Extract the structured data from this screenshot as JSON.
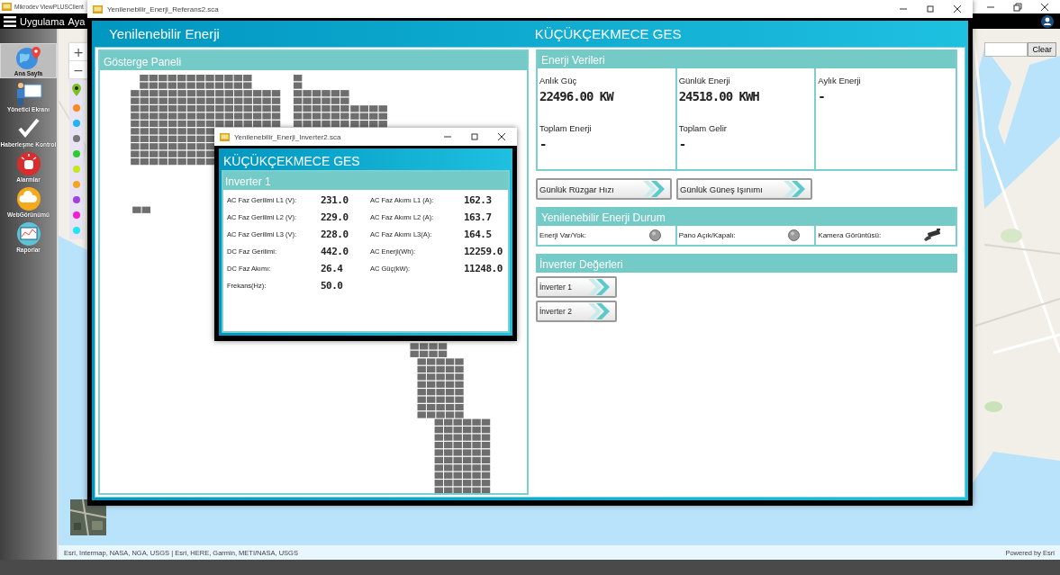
{
  "app": {
    "title": "Mikrodev ViewPLUSClient",
    "menu": [
      "Uygulama",
      "Aya"
    ]
  },
  "sidebar": [
    {
      "label": "Ana Sayfa",
      "kind": "globe",
      "selected": true
    },
    {
      "label": "Yönetici Ekranı",
      "kind": "presenter",
      "selected": false
    },
    {
      "label": "Haberleşme Kontrol",
      "kind": "check",
      "selected": false
    },
    {
      "label": "Alarmlar",
      "kind": "alarm",
      "selected": false
    },
    {
      "label": "WebGörünümü",
      "kind": "cloud",
      "selected": false
    },
    {
      "label": "Raporlar",
      "kind": "report",
      "selected": false
    }
  ],
  "map": {
    "kind": "picture",
    "zoom_in": "+",
    "zoom_out": "−",
    "clear_button": "Clear",
    "layers": [
      {
        "kind": "pin",
        "color": "#7cc11f"
      },
      {
        "kind": "dot",
        "color": "#f58a1f"
      },
      {
        "kind": "dot",
        "color": "#1fb5f5"
      },
      {
        "kind": "dot",
        "color": "#777777"
      },
      {
        "kind": "dot",
        "color": "#2ecc2e"
      },
      {
        "kind": "dot",
        "color": "#c8e61e"
      },
      {
        "kind": "dot",
        "color": "#f5a51f"
      },
      {
        "kind": "dot",
        "color": "#a040e0"
      },
      {
        "kind": "dot",
        "color": "#f020d0"
      },
      {
        "kind": "dot",
        "color": "#20e8f0"
      }
    ],
    "attribution": "Esri, Intermap, NASA, NGA, USGS | Esri, HERE, Garmin, METI/NASA, USGS",
    "powered_by": "Powered by Esri"
  },
  "main_window": {
    "title": "Yenilenebilir_Enerji_Referans2.sca",
    "heading": "Yenilenebilir Enerji",
    "site": "KÜÇÜKÇEKMECE GES",
    "dashboard": {
      "title": "Gösterge Paneli"
    },
    "energy": {
      "title": "Enerji Verileri",
      "columns": [
        {
          "items": [
            {
              "label": "Anlık Güç",
              "value": "22496.00 KW"
            },
            {
              "label": "Toplam Enerji",
              "value": "-"
            }
          ]
        },
        {
          "items": [
            {
              "label": "Günlük Enerji",
              "value": "24518.00 KWH"
            },
            {
              "label": "Toplam Gelir",
              "value": "-"
            }
          ]
        },
        {
          "items": [
            {
              "label": "Aylık Enerji",
              "value": "-"
            }
          ]
        }
      ]
    },
    "buttons": [
      "Günlük Rüzgar Hızı",
      "Günlük Güneş Işınımı"
    ],
    "status": {
      "title": "Yenilenebilir Enerji Durum",
      "items": [
        {
          "label": "Enerji Var/Yok:",
          "kind": "lamp",
          "on": false
        },
        {
          "label": "Pano Açık/Kapalı:",
          "kind": "lamp",
          "on": false
        },
        {
          "label": "Kamera Görüntüsü:",
          "kind": "camera"
        }
      ]
    },
    "inverters": {
      "title": "İnverter Değerleri",
      "buttons": [
        "İnverter 1",
        "İnverter 2"
      ]
    }
  },
  "inverter_window": {
    "title": "Yenilenebilir_Enerji_Inverter2.sca",
    "site": "KÜÇÜKÇEKMECE GES",
    "panel": "Inverter 1",
    "left": [
      {
        "label": "AC Faz Gerilimi L1 (V):",
        "value": "231.0"
      },
      {
        "label": "AC Faz Gerilimi L2 (V):",
        "value": "229.0"
      },
      {
        "label": "AC Faz Gerilimi L3 (V):",
        "value": "228.0"
      },
      {
        "label": "DC Faz Gerilimi:",
        "value": "442.0"
      },
      {
        "label": "DC Faz Akımı:",
        "value": "26.4"
      },
      {
        "label": "Frekans(Hz):",
        "value": "50.0"
      }
    ],
    "right": [
      {
        "label": "AC Faz Akımı L1 (A):",
        "value": "162.3"
      },
      {
        "label": "AC Faz Akımı L2 (A):",
        "value": "163.7"
      },
      {
        "label": "AC Faz Akımı L3(A):",
        "value": "164.5"
      },
      {
        "label": "AC Enerji(Wh):",
        "value": "12259.0"
      },
      {
        "label": "AC Güç(kW):",
        "value": "11248.0"
      }
    ]
  }
}
